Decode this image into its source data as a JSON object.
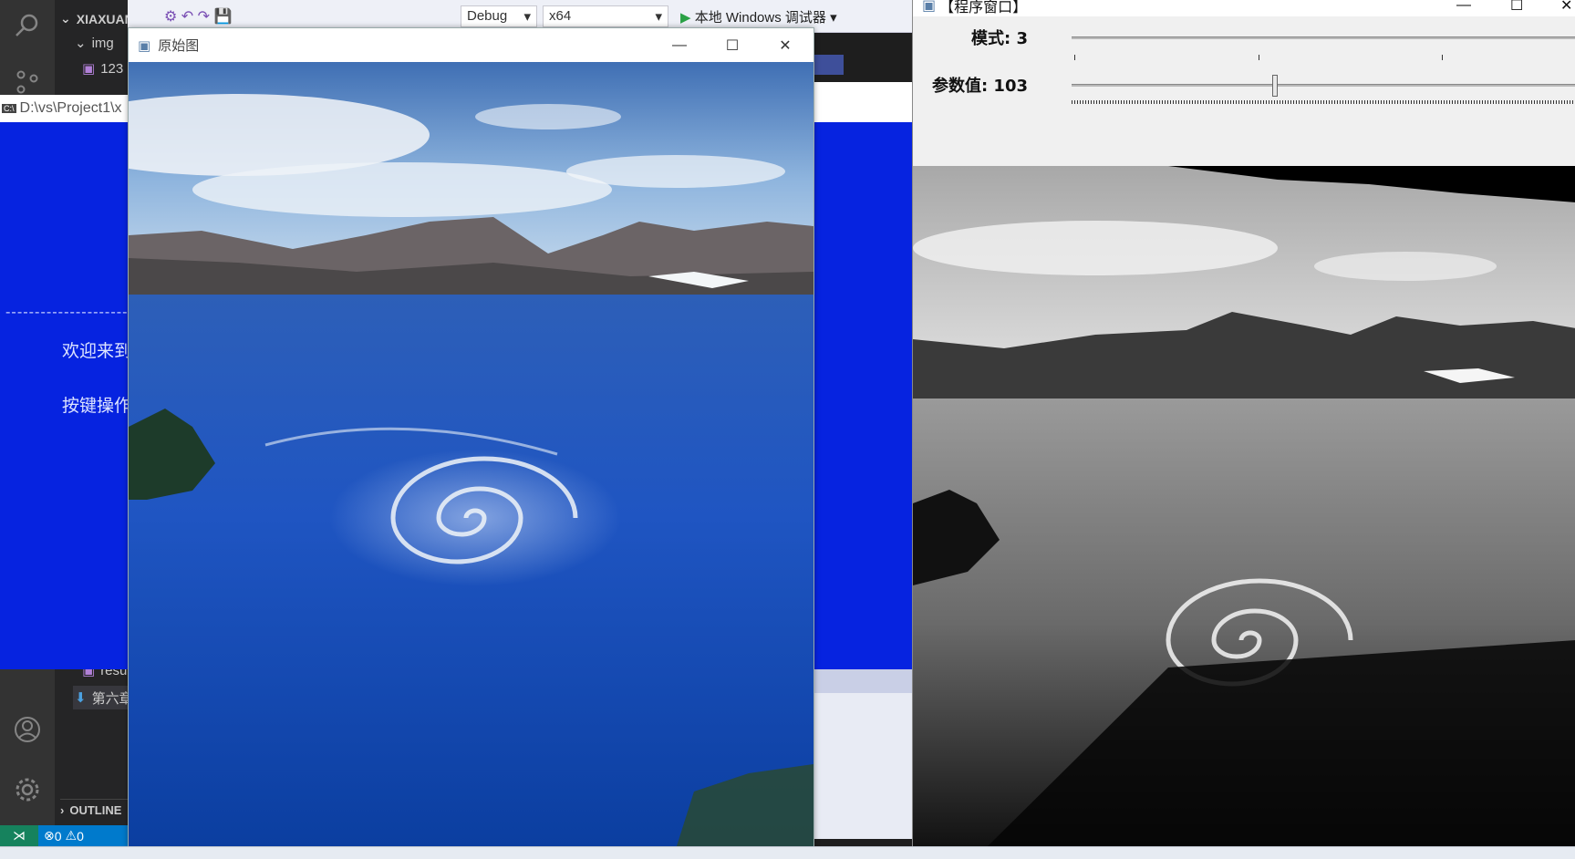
{
  "vscode": {
    "explorer": {
      "root_label": "XIAXUANZH",
      "folder_img": "img",
      "file_123": "123",
      "file_resu": "resu",
      "file_chapter": "第六章",
      "outline_label": "OUTLINE"
    },
    "status": {
      "errors": "0",
      "warnings": "0"
    }
  },
  "vs_toolbar": {
    "config": "Debug",
    "platform": "x64",
    "debugger": "本地 Windows 调试器"
  },
  "console": {
    "title": "D:\\vs\\Project1\\x",
    "dashes": "------------------------------------------------------------------------",
    "line1": "欢迎来到",
    "line2": "按键操作"
  },
  "original_window": {
    "title": "原始图"
  },
  "program_window": {
    "title": "【程序窗口】",
    "mode_label": "模式: 3",
    "param_label": "参数值: 103",
    "param_value": 103,
    "param_max": 255
  },
  "colors": {
    "console_bg": "#0623e0",
    "vscode_status": "#007acc",
    "remote_green": "#16825d"
  }
}
